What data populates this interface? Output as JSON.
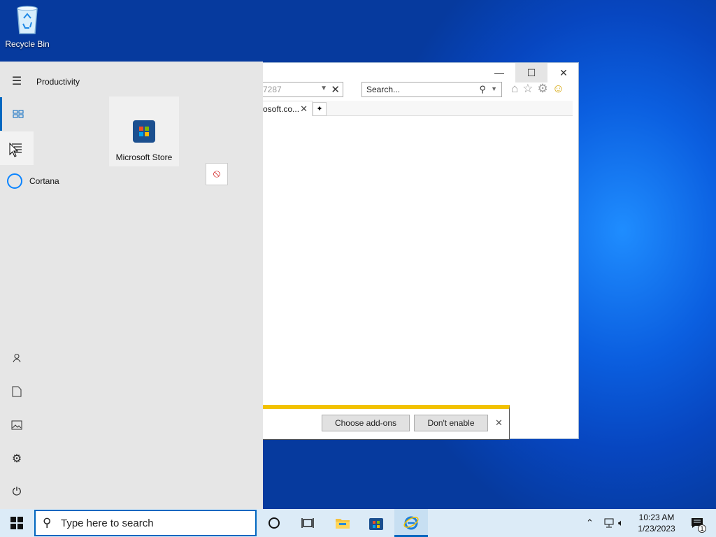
{
  "desktop": {
    "recycle_bin_label": "Recycle Bin"
  },
  "ie": {
    "address_text": "7287",
    "search_placeholder": "Search...",
    "tab_label": "osoft.co...",
    "notification": {
      "choose_addons": "Choose add-ons",
      "dont_enable": "Don't enable"
    }
  },
  "start_menu": {
    "section_title": "Productivity",
    "tiles": [
      {
        "label": "Microsoft Store"
      }
    ],
    "apps": [
      {
        "label": "Cortana"
      }
    ]
  },
  "taskbar": {
    "search_placeholder": "Type here to search",
    "time": "10:23 AM",
    "date": "1/23/2023",
    "notification_count": "1"
  },
  "colors": {
    "accent": "#0067c0",
    "notification_bar": "#f2c200"
  }
}
